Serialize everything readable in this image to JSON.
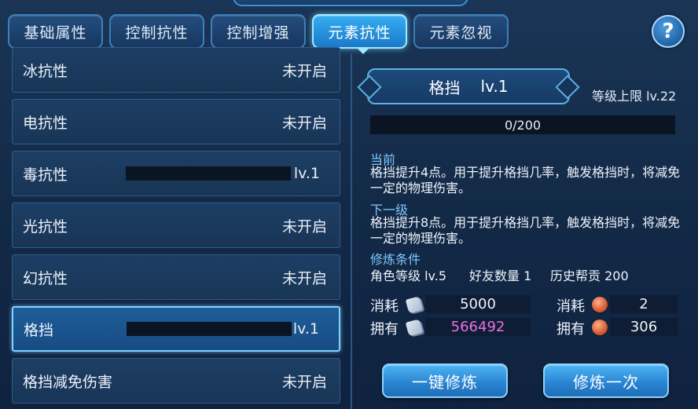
{
  "tabs": [
    {
      "label": "基础属性",
      "active": false
    },
    {
      "label": "控制抗性",
      "active": false
    },
    {
      "label": "控制增强",
      "active": false
    },
    {
      "label": "元素抗性",
      "active": true
    },
    {
      "label": "元素忽视",
      "active": false
    }
  ],
  "help_label": "?",
  "list": [
    {
      "name": "冰抗性",
      "status": "未开启",
      "level": ""
    },
    {
      "name": "电抗性",
      "status": "未开启",
      "level": ""
    },
    {
      "name": "毒抗性",
      "status": "",
      "level": "lv.1"
    },
    {
      "name": "光抗性",
      "status": "未开启",
      "level": ""
    },
    {
      "name": "幻抗性",
      "status": "未开启",
      "level": ""
    },
    {
      "name": "格挡",
      "status": "",
      "level": "lv.1"
    },
    {
      "name": "格挡减免伤害",
      "status": "未开启",
      "level": ""
    }
  ],
  "detail": {
    "name": "格挡",
    "level": "lv.1",
    "max_level": "等级上限 lv.22",
    "progress_text": "0/200",
    "progress_fraction": 0,
    "current_label": "当前",
    "current_desc": "格挡提升4点。用于提升格挡几率，触发格挡时，将减免一定的物理伤害。",
    "next_label": "下一级",
    "next_desc": "格挡提升8点。用于提升格挡几率，触发格挡时，将减免一定的物理伤害。",
    "cond_label": "修炼条件",
    "cond_role": "角色等级 lv.5",
    "cond_friends": "好友数量 1",
    "cond_contrib": "历史帮贡 200"
  },
  "resources": {
    "cost_label": "消耗",
    "own_label": "拥有",
    "scroll": {
      "icon": "scroll-icon",
      "cost": "5000",
      "own": "566492",
      "own_color": "#ea6ee6"
    },
    "coin": {
      "icon": "coin-icon",
      "cost": "2",
      "own": "306"
    }
  },
  "buttons": {
    "auto_train": "一键修炼",
    "train_once": "修炼一次"
  }
}
